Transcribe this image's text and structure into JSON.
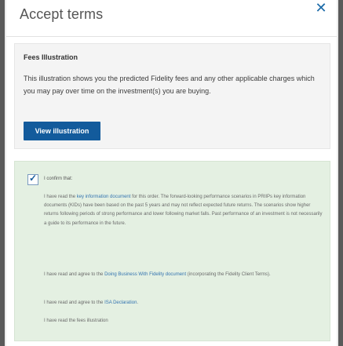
{
  "modal": {
    "title": "Accept terms",
    "close_glyph": "✕"
  },
  "fees": {
    "title": "Fees Illustration",
    "text": "This illustration shows you the predicted Fidelity fees and any other applicable charges which you may pay over time on the investment(s) you are buying.",
    "button_label": "View illustration"
  },
  "confirm": {
    "checked": true,
    "check_glyph": "✓",
    "label": "I confirm that:",
    "p1_before": "I have read the ",
    "p1_link": "key information document",
    "p1_after": " for this order. The forward-looking performance scenarios in PRIIPs key information documents (KIDs) have been based on the past 5 years and may not reflect expected future returns. The scenarios show higher returns following periods of strong performance and lower following market falls. Past performance of an investment is not necessarily a guide to its performance in the future.",
    "p2_before": "I have read and agree to the ",
    "p2_link": "Doing Business With Fidelity document",
    "p2_after": " (incorporating the Fidelity Client Terms).",
    "p3_before": "I have read and agree to the ",
    "p3_link": "ISA Declaration",
    "p3_after": ".",
    "p4": "I have read the fees illustration"
  },
  "colors": {
    "accent": "#135b9c",
    "link": "#3474b0",
    "confirm_bg": "#e4f0e2",
    "fees_bg": "#f4f4f4"
  }
}
